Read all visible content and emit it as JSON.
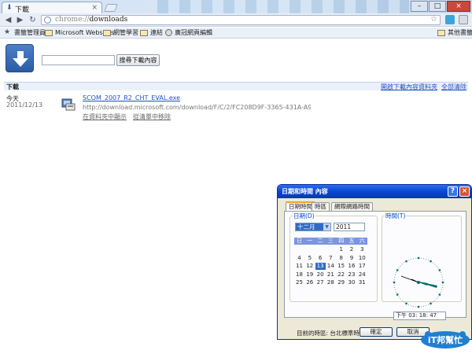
{
  "browser": {
    "tab_title": "下載",
    "tab_close": "×",
    "url_scheme": "chrome://",
    "url_path": "downloads",
    "window_controls": {
      "minimize": "–",
      "maximize": "□",
      "close": "×"
    }
  },
  "bookmarks": {
    "items": [
      "書籤管理員",
      "Microsoft Websites",
      "網管學習",
      "連結",
      "廣冠網頁編輯"
    ],
    "other": "其他書籤"
  },
  "downloads": {
    "search_placeholder": "",
    "search_button": "搜尋下載內容",
    "section_title": "下載",
    "open_folder_link": "開啟下載內容資料夾",
    "clear_all_link": "全部清除",
    "item": {
      "date_label": "今天",
      "date": "2011/12/13",
      "filename": "SCOM_2007_R2_CHT_EVAL.exe",
      "url": "http://download.microsoft.com/download/F/C/2/FC208D9F-3365-431A-A9CB-46635B...",
      "show_in_folder": "在資料夾中顯示",
      "remove_from_list": "從清單中移除"
    }
  },
  "dialog": {
    "title": "日期和時間 內容",
    "help": "?",
    "close": "×",
    "tabs": [
      "日期時間",
      "時區",
      "網際網路時間"
    ],
    "date_group": "日期(D)",
    "month": "十二月",
    "year": "2011",
    "weekdays": [
      "日",
      "一",
      "二",
      "三",
      "四",
      "五",
      "六"
    ],
    "days": [
      "1",
      "2",
      "3",
      "4",
      "5",
      "6",
      "7",
      "8",
      "9",
      "10",
      "11",
      "12",
      "13",
      "14",
      "15",
      "16",
      "17",
      "18",
      "19",
      "20",
      "21",
      "22",
      "23",
      "24",
      "25",
      "26",
      "27",
      "28",
      "29",
      "30",
      "31"
    ],
    "today": "13",
    "time_group": "時間(T)",
    "time": "下午   03: 18: 47",
    "timezone": "目前的時區: 台北標準時間",
    "ok": "確定",
    "cancel": "取消"
  },
  "watermark": {
    "text": "iT邦幫忙"
  },
  "colors": {
    "link": "#2150c0",
    "xp_title": "#0a47d6",
    "calendar_header": "#7a96df",
    "selection": "#316ac5"
  }
}
